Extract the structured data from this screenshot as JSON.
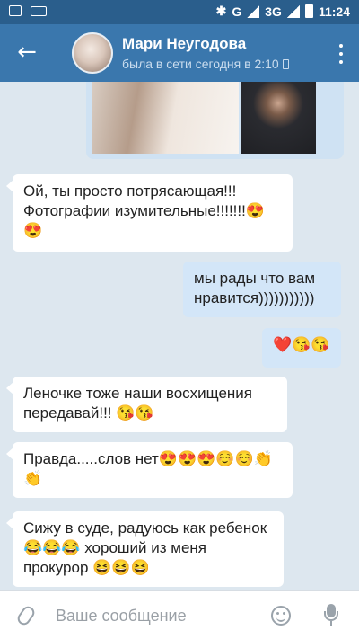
{
  "status_bar": {
    "network": "G",
    "network2": "3G",
    "time": "11:24"
  },
  "header": {
    "contact_name": "Мари Неугодова",
    "last_seen": "была в сети сегодня в 2:10"
  },
  "messages": [
    {
      "direction": "in",
      "text": "Ой, ты просто потрясающая!!! Фотографии изумительные!!!!!!!😍😍"
    },
    {
      "direction": "out",
      "text": "мы рады что вам нравится)))))))))))"
    },
    {
      "direction": "out",
      "text": "❤️😘😘"
    },
    {
      "direction": "in",
      "text": "Леночке тоже наши восхищения передавай!!! 😘😘"
    },
    {
      "direction": "in",
      "text": "Правда.....слов нет😍😍😍☺️☺️👏👏"
    },
    {
      "direction": "in",
      "text": "Сижу в суде, радуюсь как ребенок 😂😂😂 хороший из меня прокурор 😆😆😆"
    }
  ],
  "composer": {
    "placeholder": "Ваше сообщение"
  },
  "colors": {
    "header": "#3a77ad",
    "status_bar": "#2a5e8c",
    "chat_bg": "#dde7ef",
    "outgoing_bubble": "#d3e6f8",
    "incoming_bubble": "#ffffff"
  }
}
